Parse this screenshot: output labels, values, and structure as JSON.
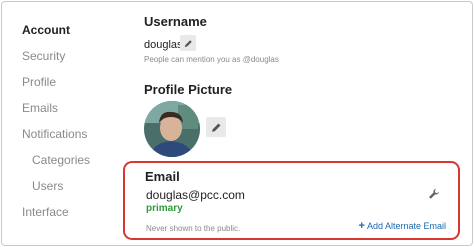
{
  "sidebar": {
    "items": [
      {
        "label": "Account",
        "active": true
      },
      {
        "label": "Security"
      },
      {
        "label": "Profile"
      },
      {
        "label": "Emails"
      },
      {
        "label": "Notifications"
      },
      {
        "label": "Categories",
        "sub": true
      },
      {
        "label": "Users",
        "sub": true
      },
      {
        "label": "Interface"
      }
    ]
  },
  "username": {
    "title": "Username",
    "value": "douglas",
    "hint": "People can mention you as @douglas",
    "edit_icon": "pencil-icon"
  },
  "profile_picture": {
    "title": "Profile Picture",
    "edit_icon": "pencil-icon"
  },
  "email": {
    "title": "Email",
    "value": "douglas@pcc.com",
    "status": "primary",
    "hint": "Never shown to the public.",
    "add_label": "Add Alternate Email",
    "add_icon": "plus-icon",
    "settings_icon": "wrench-icon"
  },
  "colors": {
    "highlight_border": "#d9362f",
    "primary_status": "#2e9a3c",
    "link": "#1c6aab"
  }
}
